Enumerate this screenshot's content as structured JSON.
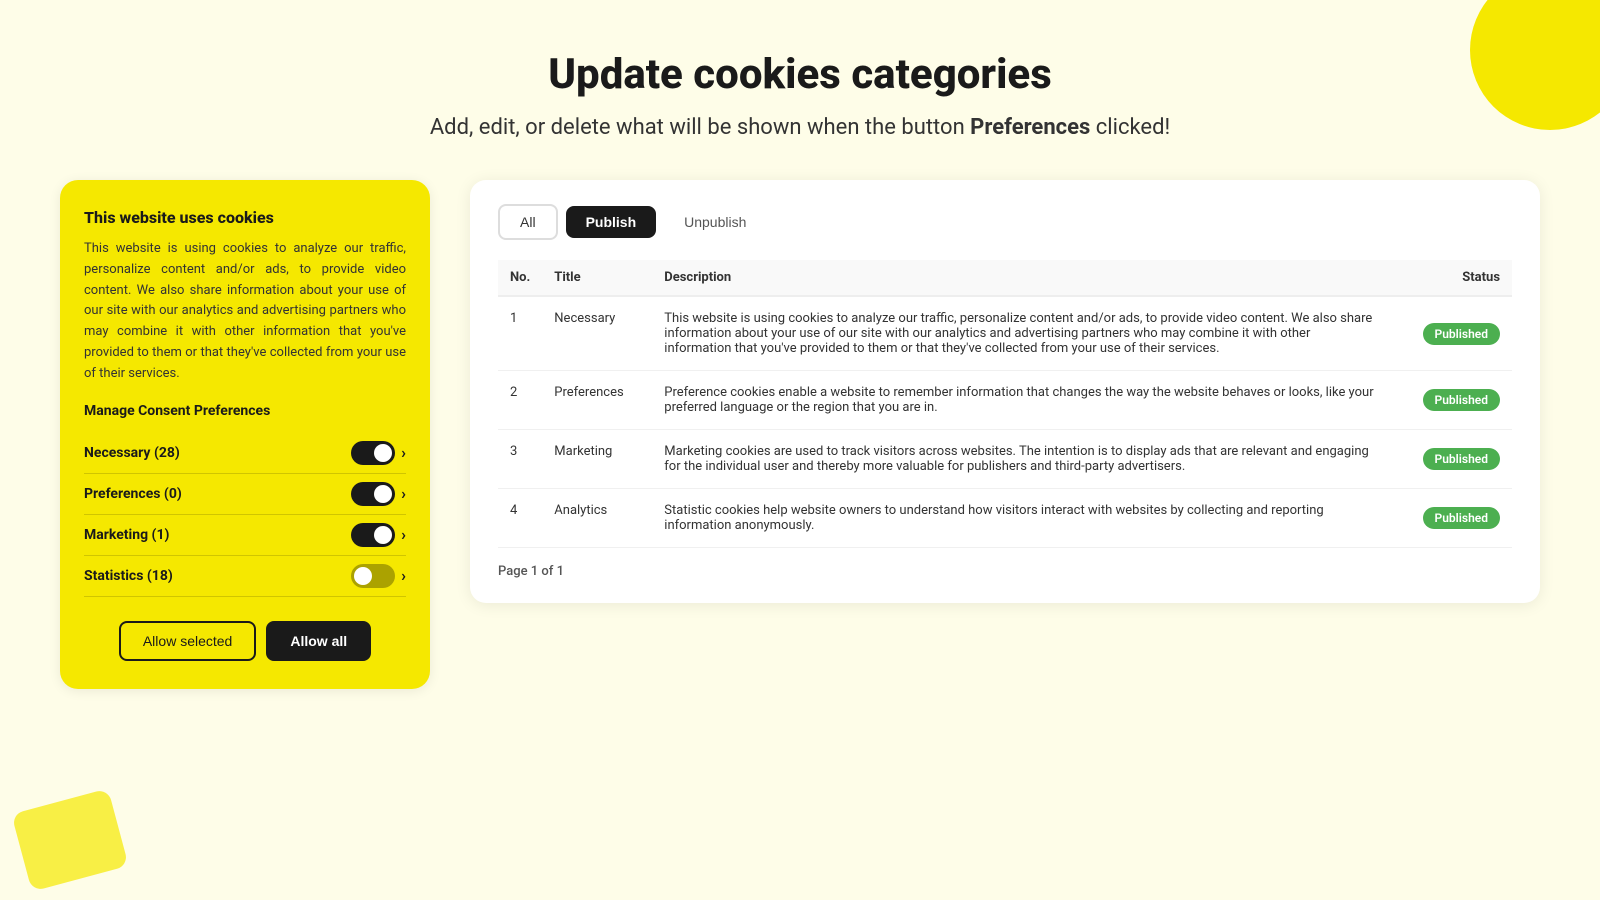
{
  "page": {
    "title": "Update cookies categories",
    "subtitle_prefix": "Add, edit, or delete what will be shown when the button ",
    "subtitle_bold": "Preferences",
    "subtitle_suffix": " clicked!"
  },
  "cookie_widget": {
    "title": "This website uses cookies",
    "description": "This website is using cookies to analyze our traffic, personalize content and/or ads, to provide video content. We also share information about your use of our site with our analytics and advertising partners who may combine it with other information that you've provided to them or that they've collected from your use of their services.",
    "manage_title": "Manage Consent Preferences",
    "preferences": [
      {
        "label": "Necessary (28)",
        "toggle_on": true
      },
      {
        "label": "Preferences (0)",
        "toggle_on": true
      },
      {
        "label": "Marketing (1)",
        "toggle_on": true
      },
      {
        "label": "Statistics (18)",
        "toggle_on": false
      }
    ],
    "btn_allow_selected": "Allow selected",
    "btn_allow_all": "Allow all"
  },
  "table_panel": {
    "toolbar": {
      "tab_all": "All",
      "tab_publish": "Publish",
      "tab_unpublish": "Unpublish"
    },
    "columns": [
      "No.",
      "Title",
      "Description",
      "Status"
    ],
    "rows": [
      {
        "no": "1",
        "title": "Necessary",
        "description": "This website is using cookies to analyze our traffic, personalize content and/or ads, to provide video content. We also share information about your use of our site with our analytics and advertising partners who may combine it with other information that you've provided to them or that they've collected from your use of their services.",
        "status": "Published"
      },
      {
        "no": "2",
        "title": "Preferences",
        "description": "Preference cookies enable a website to remember information that changes the way the website behaves or looks, like your preferred language or the region that you are in.",
        "status": "Published"
      },
      {
        "no": "3",
        "title": "Marketing",
        "description": "Marketing cookies are used to track visitors across websites. The intention is to display ads that are relevant and engaging for the individual user and thereby more valuable for publishers and third-party advertisers.",
        "status": "Published"
      },
      {
        "no": "4",
        "title": "Analytics",
        "description": "Statistic cookies help website owners to understand how visitors interact with websites by collecting and reporting information anonymously.",
        "status": "Published"
      }
    ],
    "pagination": "Page 1 of 1"
  }
}
